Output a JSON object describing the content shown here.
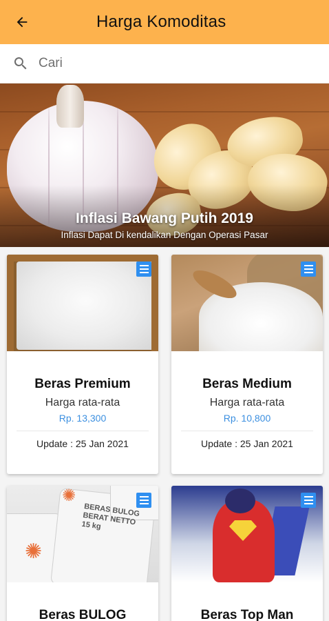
{
  "appbar": {
    "title": "Harga Komoditas",
    "back_icon": "arrow-left-icon"
  },
  "search": {
    "placeholder": "Cari",
    "value": "",
    "icon": "search-icon"
  },
  "banner": {
    "title": "Inflasi Bawang Putih 2019",
    "subtitle": "Inflasi Dapat Di kendalikan Dengan Operasi Pasar"
  },
  "colors": {
    "accent": "#fdb24d",
    "price": "#3b8fe0",
    "badge": "#2f8ff0"
  },
  "commodities": [
    {
      "name": "Beras Premium",
      "label": "Harga rata-rata",
      "price": "Rp. 13,300",
      "update": "Update : 25 Jan 2021"
    },
    {
      "name": "Beras Medium",
      "label": "Harga rata-rata",
      "price": "Rp. 10,800",
      "update": "Update : 25 Jan 2021"
    },
    {
      "name": "Beras BULOG",
      "label": "",
      "price": "",
      "update": "",
      "logo_text": "BERAS BULOG BERAT NETTO 15 kg"
    },
    {
      "name": "Beras Top Man",
      "label": "",
      "price": "",
      "update": ""
    }
  ]
}
